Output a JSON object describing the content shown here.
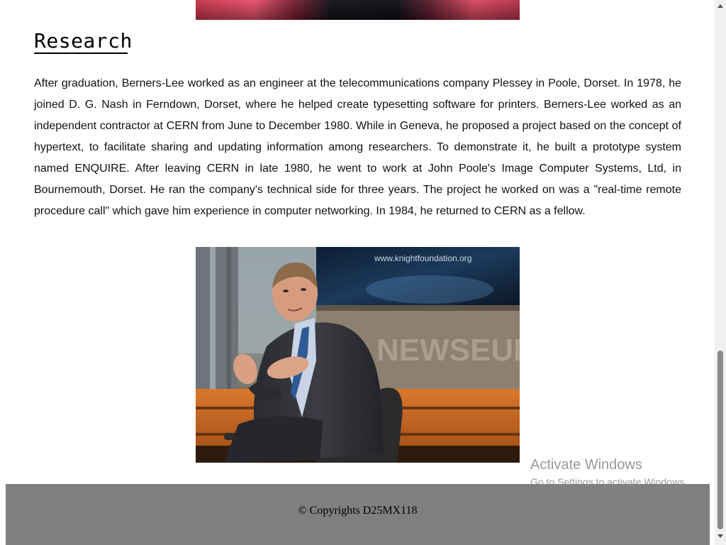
{
  "section": {
    "title": "Research",
    "paragraph": "After graduation, Berners-Lee worked as an engineer at the telecommunications company Plessey in Poole, Dorset. In 1978, he joined D. G. Nash in Ferndown, Dorset, where he helped create typesetting software for printers. Berners-Lee worked as an independent contractor at CERN from June to December 1980. While in Geneva, he proposed a project based on the concept of hypertext, to facilitate sharing and updating information among researchers. To demonstrate it, he built a prototype system named ENQUIRE. After leaving CERN in late 1980, he went to work at John Poole's Image Computer Systems, Ltd, in Bournemouth, Dorset. He ran the company's technical side for three years. The project he worked on was a \"real-time remote procedure call\" which gave him experience in computer networking. In 1984, he returned to CERN as a fellow."
  },
  "photo": {
    "backdrop_text": "www.knightfoundation.org",
    "sign_text": "NEWSEUM"
  },
  "footer": {
    "text": "© Copyrights D25MX118"
  },
  "watermark": {
    "title": "Activate Windows",
    "subtitle": "Go to Settings to activate Windows."
  },
  "colors": {
    "footer_bg": "#808080",
    "scroll_thumb": "#8a8a8a"
  }
}
